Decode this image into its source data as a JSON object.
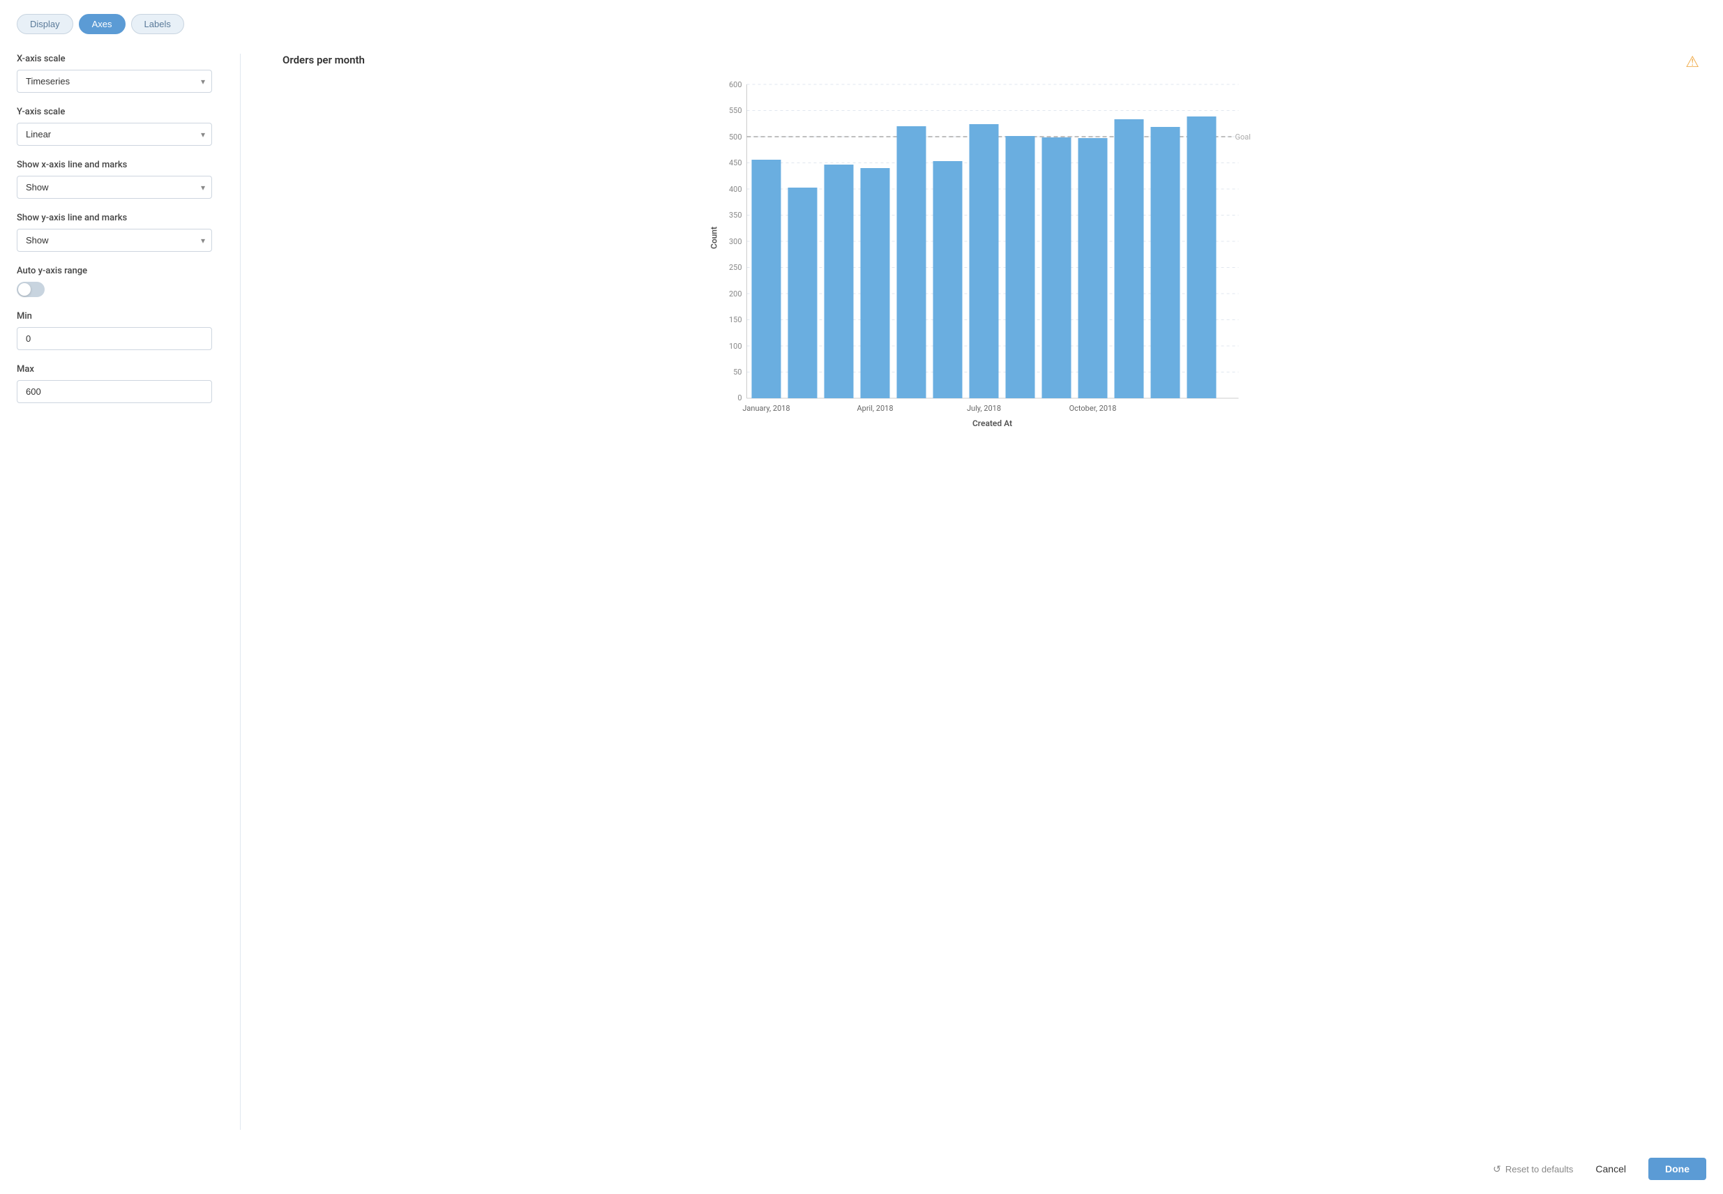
{
  "tabs": [
    {
      "label": "Display",
      "id": "display",
      "active": false
    },
    {
      "label": "Axes",
      "id": "axes",
      "active": true
    },
    {
      "label": "Labels",
      "id": "labels",
      "active": false
    }
  ],
  "left_panel": {
    "xaxis_scale_label": "X-axis scale",
    "xaxis_scale_value": "Timeseries",
    "yaxis_scale_label": "Y-axis scale",
    "yaxis_scale_value": "Linear",
    "show_xaxis_label": "Show x-axis line and marks",
    "show_xaxis_value": "Show",
    "show_yaxis_label": "Show y-axis line and marks",
    "show_yaxis_value": "Show",
    "auto_yaxis_label": "Auto y-axis range",
    "auto_yaxis_on": false,
    "min_label": "Min",
    "min_value": "0",
    "max_label": "Max",
    "max_value": "600"
  },
  "chart": {
    "title": "Orders per month",
    "x_axis_label": "Created At",
    "y_axis_label": "Count",
    "goal_label": "Goal",
    "goal_value": 500,
    "y_max": 600,
    "y_min": 0,
    "y_ticks": [
      0,
      50,
      100,
      150,
      200,
      250,
      300,
      350,
      400,
      450,
      500,
      550,
      600
    ],
    "x_labels": [
      "January, 2018",
      "April, 2018",
      "July, 2018",
      "October, 2018"
    ],
    "bars": [
      {
        "month": "Jan",
        "value": 455
      },
      {
        "month": "Feb",
        "value": 403
      },
      {
        "month": "Mar",
        "value": 447
      },
      {
        "month": "Apr",
        "value": 440
      },
      {
        "month": "May",
        "value": 520
      },
      {
        "month": "Jun",
        "value": 454
      },
      {
        "month": "Jul",
        "value": 524
      },
      {
        "month": "Aug",
        "value": 501
      },
      {
        "month": "Sep",
        "value": 499
      },
      {
        "month": "Oct",
        "value": 497
      },
      {
        "month": "Nov",
        "value": 533
      },
      {
        "month": "Dec",
        "value": 519
      },
      {
        "month": "Jan2",
        "value": 539
      }
    ],
    "bar_color": "#6aaee0"
  },
  "footer": {
    "reset_label": "Reset to defaults",
    "cancel_label": "Cancel",
    "done_label": "Done"
  }
}
